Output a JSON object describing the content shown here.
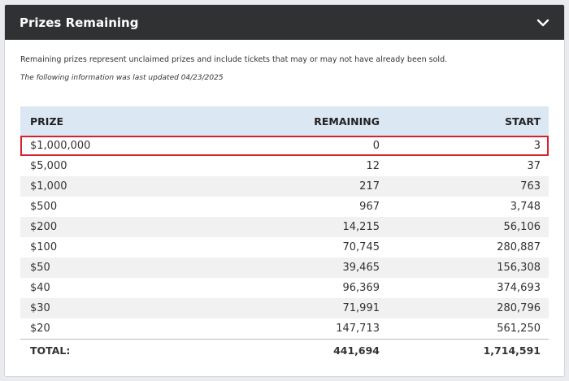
{
  "header": {
    "title": "Prizes Remaining"
  },
  "info": {
    "description": "Remaining prizes represent unclaimed prizes and include tickets that may or may not have already been sold.",
    "updated": "The following information was last updated 04/23/2025"
  },
  "table": {
    "columns": [
      "PRIZE",
      "REMAINING",
      "START"
    ],
    "rows": [
      {
        "prize": "$1,000,000",
        "remaining": "0",
        "start": "3"
      },
      {
        "prize": "$5,000",
        "remaining": "12",
        "start": "37"
      },
      {
        "prize": "$1,000",
        "remaining": "217",
        "start": "763"
      },
      {
        "prize": "$500",
        "remaining": "967",
        "start": "3,748"
      },
      {
        "prize": "$200",
        "remaining": "14,215",
        "start": "56,106"
      },
      {
        "prize": "$100",
        "remaining": "70,745",
        "start": "280,887"
      },
      {
        "prize": "$50",
        "remaining": "39,465",
        "start": "156,308"
      },
      {
        "prize": "$40",
        "remaining": "96,369",
        "start": "374,693"
      },
      {
        "prize": "$30",
        "remaining": "71,991",
        "start": "280,796"
      },
      {
        "prize": "$20",
        "remaining": "147,713",
        "start": "561,250"
      }
    ],
    "total": {
      "label": "TOTAL:",
      "remaining": "441,694",
      "start": "1,714,591"
    }
  },
  "colors": {
    "header_bg": "#2f3133",
    "table_header_bg": "#dbe7f3",
    "highlight": "#d6222a"
  }
}
